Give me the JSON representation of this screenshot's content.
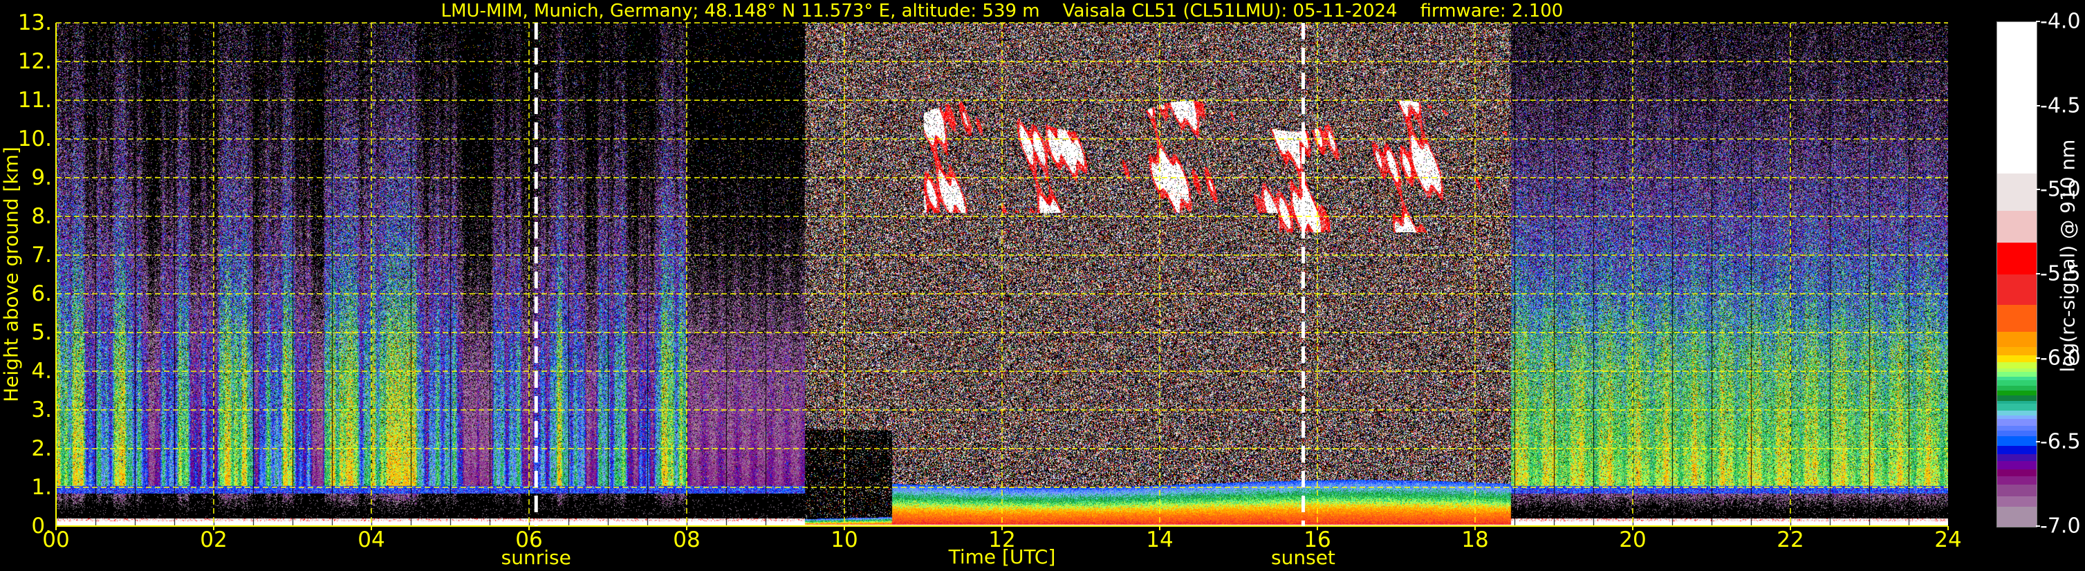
{
  "chart_data": {
    "type": "heatmap",
    "title": "LMU-MIM, Munich, Germany; 48.148° N 11.573° E, altitude: 539 m    Vaisala CL51 (CL51LMU): 05-11-2024    firmware: 2.100",
    "xlabel": "Time [UTC]",
    "ylabel": "Height above ground [km]",
    "xlim": [
      0,
      24
    ],
    "ylim": [
      0,
      13
    ],
    "x_ticks": [
      0,
      2,
      4,
      6,
      8,
      10,
      12,
      14,
      16,
      18,
      20,
      22,
      24
    ],
    "x_tick_labels": [
      "00",
      "02",
      "04",
      "06",
      "08",
      "10",
      "12",
      "14",
      "16",
      "18",
      "20",
      "22",
      "24"
    ],
    "y_ticks": [
      0,
      1,
      2,
      3,
      4,
      5,
      6,
      7,
      8,
      9,
      10,
      11,
      12,
      13
    ],
    "y_tick_labels": [
      "0.",
      "1.",
      "2.",
      "3.",
      "4.",
      "5.",
      "6.",
      "7.",
      "8.",
      "9.",
      "10.",
      "11.",
      "12.",
      "13."
    ],
    "grid": true,
    "grid_x_step_hours": 2,
    "grid_y_step_km": 1,
    "grid_color": "#ffff00",
    "events": [
      {
        "name": "sunrise",
        "time": 6.09
      },
      {
        "name": "sunset",
        "time": 15.82
      }
    ],
    "colorbar": {
      "label": "log(rc-signal) @ 910 nm",
      "range": [
        -7.0,
        -4.0
      ],
      "ticks": [
        -4.0,
        -4.5,
        -5.0,
        -5.5,
        -6.0,
        -6.5,
        -7.0
      ],
      "tick_labels": [
        "-4.0",
        "-4.5",
        "-5.0",
        "-5.5",
        "-6.0",
        "-6.5",
        "-7.0"
      ],
      "location": "right",
      "bins": [
        {
          "lo": -4.9,
          "hi": -4.0,
          "color": "#ffffff"
        },
        {
          "lo": -5.12,
          "hi": -4.9,
          "color": "#ece3e3"
        },
        {
          "lo": -5.31,
          "hi": -5.12,
          "color": "#f0c4c4"
        },
        {
          "lo": -5.5,
          "hi": -5.31,
          "color": "#ff0000"
        },
        {
          "lo": -5.68,
          "hi": -5.5,
          "color": "#f02828"
        },
        {
          "lo": -5.84,
          "hi": -5.68,
          "color": "#ff6010"
        },
        {
          "lo": -5.93,
          "hi": -5.84,
          "color": "#ff9a00"
        },
        {
          "lo": -5.98,
          "hi": -5.93,
          "color": "#ffb000"
        },
        {
          "lo": -6.02,
          "hi": -5.98,
          "color": "#ffe000"
        },
        {
          "lo": -6.06,
          "hi": -6.02,
          "color": "#ccff40"
        },
        {
          "lo": -6.08,
          "hi": -6.06,
          "color": "#b0ff60"
        },
        {
          "lo": -6.11,
          "hi": -6.08,
          "color": "#80ff80"
        },
        {
          "lo": -6.13,
          "hi": -6.11,
          "color": "#40e090"
        },
        {
          "lo": -6.16,
          "hi": -6.13,
          "color": "#30d070"
        },
        {
          "lo": -6.19,
          "hi": -6.16,
          "color": "#20b850"
        },
        {
          "lo": -6.22,
          "hi": -6.19,
          "color": "#10a010"
        },
        {
          "lo": -6.25,
          "hi": -6.22,
          "color": "#108040"
        },
        {
          "lo": -6.27,
          "hi": -6.25,
          "color": "#20b090"
        },
        {
          "lo": -6.31,
          "hi": -6.27,
          "color": "#30c0a0"
        },
        {
          "lo": -6.34,
          "hi": -6.31,
          "color": "#70d0e0"
        },
        {
          "lo": -6.36,
          "hi": -6.34,
          "color": "#80b0ff"
        },
        {
          "lo": -6.4,
          "hi": -6.36,
          "color": "#8090ff"
        },
        {
          "lo": -6.43,
          "hi": -6.4,
          "color": "#6080ff"
        },
        {
          "lo": -6.46,
          "hi": -6.43,
          "color": "#4070ff"
        },
        {
          "lo": -6.52,
          "hi": -6.46,
          "color": "#0060ff"
        },
        {
          "lo": -6.57,
          "hi": -6.52,
          "color": "#0010e0"
        },
        {
          "lo": -6.61,
          "hi": -6.57,
          "color": "#4010b0"
        },
        {
          "lo": -6.66,
          "hi": -6.61,
          "color": "#7000a0"
        },
        {
          "lo": -6.7,
          "hi": -6.66,
          "color": "#800070"
        },
        {
          "lo": -6.75,
          "hi": -6.7,
          "color": "#882088"
        },
        {
          "lo": -6.82,
          "hi": -6.75,
          "color": "#904890"
        },
        {
          "lo": -6.88,
          "hi": -6.82,
          "color": "#a06ca0"
        },
        {
          "lo": -7.0,
          "hi": -6.88,
          "color": "#a890a8"
        }
      ]
    },
    "features": {
      "night_aerosol_layer_km": [
        1.0,
        5.0
      ],
      "night_aerosol_peak_log_signal": -5.97,
      "daytime_boundary_layer_top_km": 1.1,
      "daytime_boundary_layer_start_hour": 10.6,
      "cirrus_cloud_hours": [
        11.0,
        18.4
      ],
      "cirrus_cloud_heights_km": [
        7.6,
        11.0
      ],
      "cirrus_log_signal": -4.5,
      "daylight_noise_hours": [
        9.5,
        18.45
      ]
    }
  }
}
